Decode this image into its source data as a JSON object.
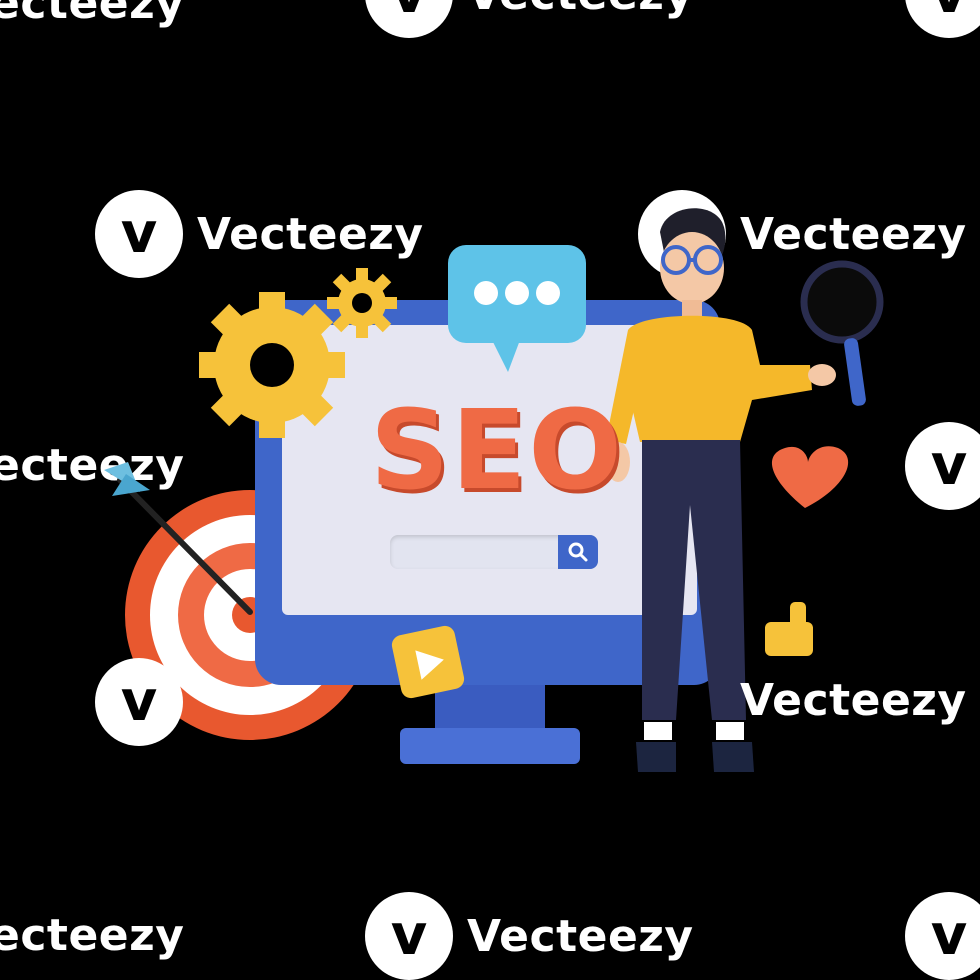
{
  "watermark": {
    "brand": "Vecteezy",
    "brand_cut_left": "ecteezy",
    "brand_cut_top": "Vecteezy",
    "logo_glyph": "v"
  },
  "scene": {
    "monitor_heading": "SEO",
    "search_placeholder": "",
    "icons": [
      "gear-icon",
      "speech-bubble-icon",
      "target-icon",
      "arrow-icon",
      "play-icon",
      "heart-icon",
      "thumbs-up-icon",
      "magnifier-icon",
      "search-icon"
    ],
    "colors": {
      "background": "#000000",
      "monitor_frame": "#3f66c9",
      "screen": "#e6e6f2",
      "seo_orange": "#ef6a45",
      "gear_yellow": "#f6c23a",
      "bubble_blue": "#5ec3e8",
      "shirt_yellow": "#f5b82a",
      "pants_navy": "#2a2d4f"
    }
  }
}
